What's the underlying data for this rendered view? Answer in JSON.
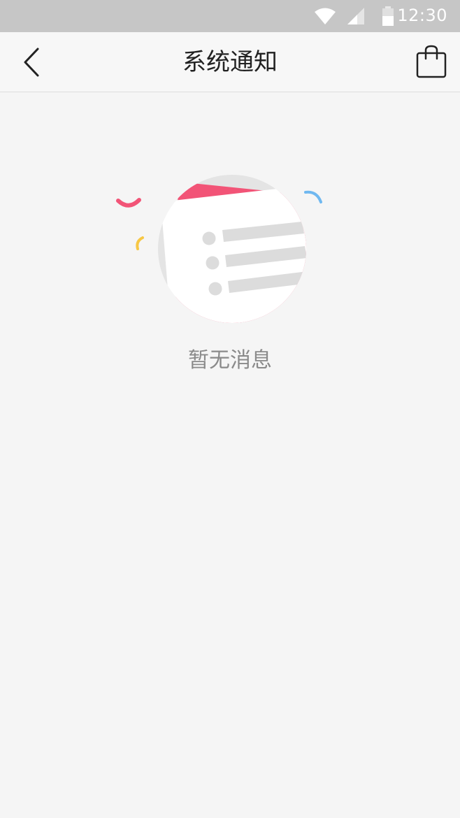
{
  "status_bar": {
    "time": "12:30",
    "icons": [
      "wifi-icon",
      "cellular-signal-icon",
      "battery-icon"
    ]
  },
  "nav": {
    "title": "系统通知",
    "back_icon": "chevron-left-icon",
    "right_icon": "shopping-bag-icon"
  },
  "empty_state": {
    "message": "暂无消息",
    "illustration": "empty-message-list-icon"
  },
  "colors": {
    "status_bar_bg": "#c6c6c6",
    "nav_bg": "#f7f7f7",
    "page_bg": "#f5f5f5",
    "accent_pink": "#f25477",
    "accent_blue": "#6fb8f0",
    "accent_yellow": "#f7c744",
    "placeholder_gray": "#dcdcdc"
  }
}
